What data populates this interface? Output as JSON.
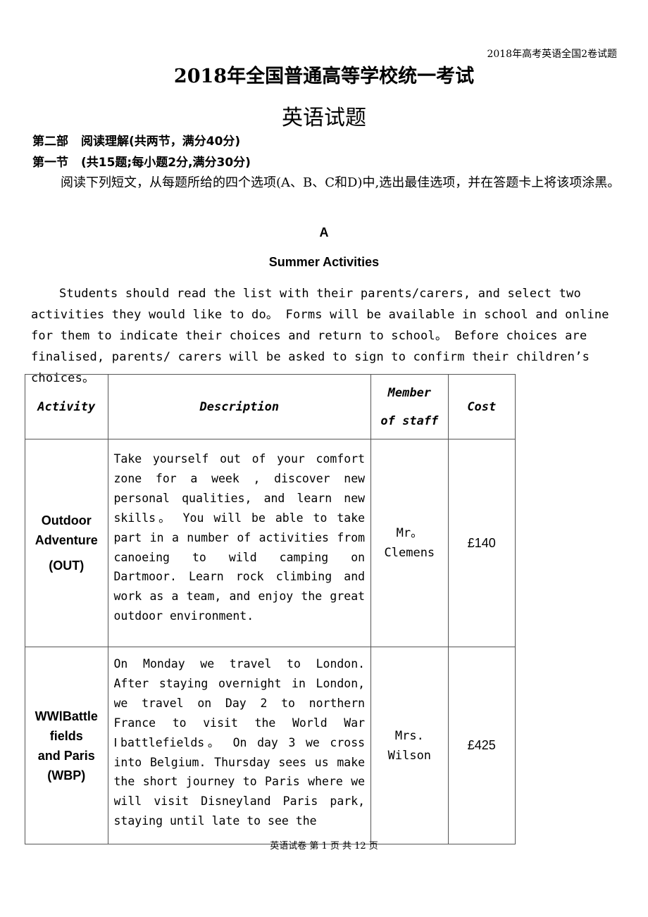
{
  "running_header": "2018年高考英语全国2卷试题",
  "main_title": "2018年全国普通高等学校统一考试",
  "sub_title": "英语试题",
  "part_heading": {
    "part": "第二部",
    "title": "阅读理解(共两节，满分40分)"
  },
  "section_heading": {
    "section": "第一节",
    "title": "(共15题;每小题2分,满分30分)"
  },
  "instructions": "阅读下列短文，从每题所给的四个选项(A、B、C和D)中,选出最佳选项，并在答题卡上将该项涂黑。",
  "passage": {
    "letter": "A",
    "title": "Summer Activities",
    "intro": "Students should read the list with their parents/carers,  and select two activities they would like to do。 Forms will be available in school and online for them to indicate their choices and return to school。 Before choices are finalised, parents/ carers will be asked to sign to confirm their children’s choices。"
  },
  "table": {
    "headers": {
      "activity": "Activity",
      "description": "Description",
      "staff_line1": "Member",
      "staff_line2": "of staff",
      "cost": "Cost"
    },
    "rows": [
      {
        "activity_line1": "Outdoor",
        "activity_line2": "Adventure",
        "code": "(OUT)",
        "description": "Take yourself out of your comfort zone for a week ,  discover new personal qualities, and learn new skills。 You will be able to take part in a number of activities from canoeing to wild camping on Dartmoor. Learn rock climbing and work as a team, and enjoy the great outdoor environment.",
        "staff_line1": "Mr。",
        "staff_line2": "Clemens",
        "cost": "£140"
      },
      {
        "activity_line1": "WWⅠBattle",
        "activity_line2": "fields",
        "activity_line3": "and Paris",
        "code": "(WBP)",
        "description": "On Monday we travel to London. After staying overnight in London, we travel on Day 2 to northern France to visit the World War Ⅰbattlefields。 On day 3 we cross into Belgium. Thursday sees us make the short journey to Paris where we will visit Disneyland Paris park, staying until late to see the",
        "staff_line1": "Mrs.",
        "staff_line2": "Wilson",
        "cost": "£425"
      }
    ]
  },
  "footer": "英语试卷  第 1 页 共 12 页"
}
